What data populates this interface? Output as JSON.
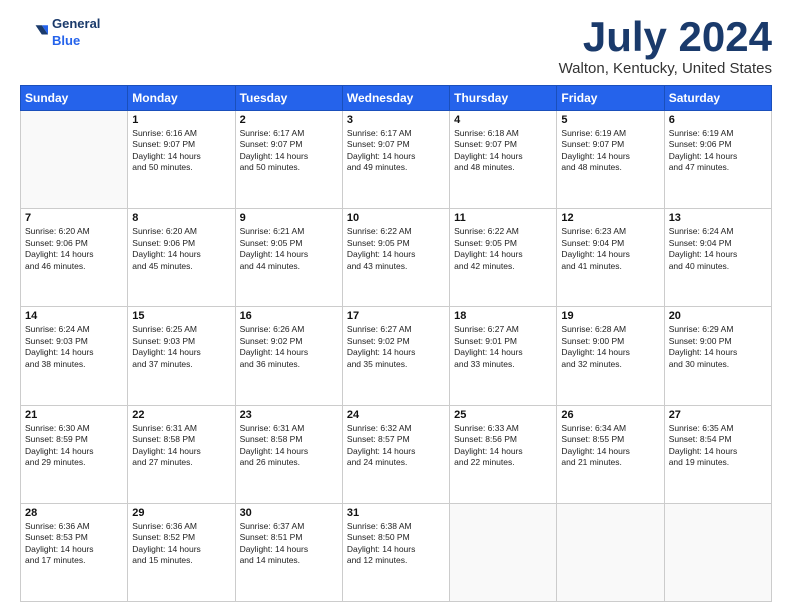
{
  "logo": {
    "line1": "General",
    "line2": "Blue"
  },
  "title": "July 2024",
  "subtitle": "Walton, Kentucky, United States",
  "days_header": [
    "Sunday",
    "Monday",
    "Tuesday",
    "Wednesday",
    "Thursday",
    "Friday",
    "Saturday"
  ],
  "weeks": [
    [
      {
        "num": "",
        "info": ""
      },
      {
        "num": "1",
        "info": "Sunrise: 6:16 AM\nSunset: 9:07 PM\nDaylight: 14 hours\nand 50 minutes."
      },
      {
        "num": "2",
        "info": "Sunrise: 6:17 AM\nSunset: 9:07 PM\nDaylight: 14 hours\nand 50 minutes."
      },
      {
        "num": "3",
        "info": "Sunrise: 6:17 AM\nSunset: 9:07 PM\nDaylight: 14 hours\nand 49 minutes."
      },
      {
        "num": "4",
        "info": "Sunrise: 6:18 AM\nSunset: 9:07 PM\nDaylight: 14 hours\nand 48 minutes."
      },
      {
        "num": "5",
        "info": "Sunrise: 6:19 AM\nSunset: 9:07 PM\nDaylight: 14 hours\nand 48 minutes."
      },
      {
        "num": "6",
        "info": "Sunrise: 6:19 AM\nSunset: 9:06 PM\nDaylight: 14 hours\nand 47 minutes."
      }
    ],
    [
      {
        "num": "7",
        "info": "Sunrise: 6:20 AM\nSunset: 9:06 PM\nDaylight: 14 hours\nand 46 minutes."
      },
      {
        "num": "8",
        "info": "Sunrise: 6:20 AM\nSunset: 9:06 PM\nDaylight: 14 hours\nand 45 minutes."
      },
      {
        "num": "9",
        "info": "Sunrise: 6:21 AM\nSunset: 9:05 PM\nDaylight: 14 hours\nand 44 minutes."
      },
      {
        "num": "10",
        "info": "Sunrise: 6:22 AM\nSunset: 9:05 PM\nDaylight: 14 hours\nand 43 minutes."
      },
      {
        "num": "11",
        "info": "Sunrise: 6:22 AM\nSunset: 9:05 PM\nDaylight: 14 hours\nand 42 minutes."
      },
      {
        "num": "12",
        "info": "Sunrise: 6:23 AM\nSunset: 9:04 PM\nDaylight: 14 hours\nand 41 minutes."
      },
      {
        "num": "13",
        "info": "Sunrise: 6:24 AM\nSunset: 9:04 PM\nDaylight: 14 hours\nand 40 minutes."
      }
    ],
    [
      {
        "num": "14",
        "info": "Sunrise: 6:24 AM\nSunset: 9:03 PM\nDaylight: 14 hours\nand 38 minutes."
      },
      {
        "num": "15",
        "info": "Sunrise: 6:25 AM\nSunset: 9:03 PM\nDaylight: 14 hours\nand 37 minutes."
      },
      {
        "num": "16",
        "info": "Sunrise: 6:26 AM\nSunset: 9:02 PM\nDaylight: 14 hours\nand 36 minutes."
      },
      {
        "num": "17",
        "info": "Sunrise: 6:27 AM\nSunset: 9:02 PM\nDaylight: 14 hours\nand 35 minutes."
      },
      {
        "num": "18",
        "info": "Sunrise: 6:27 AM\nSunset: 9:01 PM\nDaylight: 14 hours\nand 33 minutes."
      },
      {
        "num": "19",
        "info": "Sunrise: 6:28 AM\nSunset: 9:00 PM\nDaylight: 14 hours\nand 32 minutes."
      },
      {
        "num": "20",
        "info": "Sunrise: 6:29 AM\nSunset: 9:00 PM\nDaylight: 14 hours\nand 30 minutes."
      }
    ],
    [
      {
        "num": "21",
        "info": "Sunrise: 6:30 AM\nSunset: 8:59 PM\nDaylight: 14 hours\nand 29 minutes."
      },
      {
        "num": "22",
        "info": "Sunrise: 6:31 AM\nSunset: 8:58 PM\nDaylight: 14 hours\nand 27 minutes."
      },
      {
        "num": "23",
        "info": "Sunrise: 6:31 AM\nSunset: 8:58 PM\nDaylight: 14 hours\nand 26 minutes."
      },
      {
        "num": "24",
        "info": "Sunrise: 6:32 AM\nSunset: 8:57 PM\nDaylight: 14 hours\nand 24 minutes."
      },
      {
        "num": "25",
        "info": "Sunrise: 6:33 AM\nSunset: 8:56 PM\nDaylight: 14 hours\nand 22 minutes."
      },
      {
        "num": "26",
        "info": "Sunrise: 6:34 AM\nSunset: 8:55 PM\nDaylight: 14 hours\nand 21 minutes."
      },
      {
        "num": "27",
        "info": "Sunrise: 6:35 AM\nSunset: 8:54 PM\nDaylight: 14 hours\nand 19 minutes."
      }
    ],
    [
      {
        "num": "28",
        "info": "Sunrise: 6:36 AM\nSunset: 8:53 PM\nDaylight: 14 hours\nand 17 minutes."
      },
      {
        "num": "29",
        "info": "Sunrise: 6:36 AM\nSunset: 8:52 PM\nDaylight: 14 hours\nand 15 minutes."
      },
      {
        "num": "30",
        "info": "Sunrise: 6:37 AM\nSunset: 8:51 PM\nDaylight: 14 hours\nand 14 minutes."
      },
      {
        "num": "31",
        "info": "Sunrise: 6:38 AM\nSunset: 8:50 PM\nDaylight: 14 hours\nand 12 minutes."
      },
      {
        "num": "",
        "info": ""
      },
      {
        "num": "",
        "info": ""
      },
      {
        "num": "",
        "info": ""
      }
    ]
  ]
}
